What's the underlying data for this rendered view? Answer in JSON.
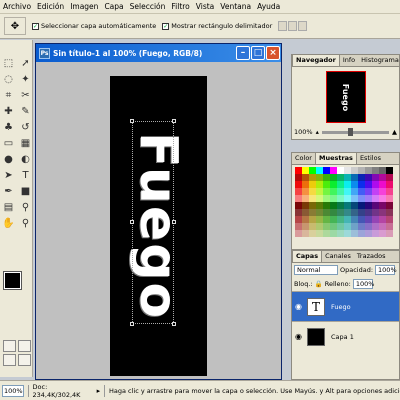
{
  "menu": [
    "Archivo",
    "Edición",
    "Imagen",
    "Capa",
    "Selección",
    "Filtro",
    "Vista",
    "Ventana",
    "Ayuda"
  ],
  "options": {
    "tool_icon": "move-tool-icon",
    "auto_select_label": "Seleccionar capa automáticamente",
    "auto_select_checked": true,
    "show_bounds_label": "Mostrar rectángulo delimitador",
    "show_bounds_checked": true
  },
  "document": {
    "title": "Sin título-1 al 100% (Fuego, RGB/8)",
    "canvas_text": "Fuego",
    "canvas_bg": "#000000"
  },
  "navigator": {
    "tabs": [
      "Navegador",
      "Info",
      "Histograma"
    ],
    "zoom": "100%",
    "preview_text": "Fuego"
  },
  "color_panel": {
    "tabs": [
      "Color",
      "Muestras",
      "Estilos"
    ]
  },
  "layers_panel": {
    "tabs": [
      "Capas",
      "Canales",
      "Trazados"
    ],
    "blend_mode": "Normal",
    "opacity_label": "Opacidad:",
    "opacity": "100%",
    "lock_label": "Bloq.:",
    "fill_label": "Relleno:",
    "fill": "100%",
    "layers": [
      {
        "name": "Fuego",
        "type": "text",
        "selected": true
      },
      {
        "name": "Capa 1",
        "type": "raster",
        "selected": false
      }
    ]
  },
  "status": {
    "zoom": "100%",
    "doc_info": "Doc: 234,4K/302,4K",
    "hint": "Haga clic y arrastre para mover la capa o selección. Use Mayús. y Alt para opciones adicionales."
  },
  "colors": {
    "accent": "#316ac5",
    "titlebar": "#0a5ccf",
    "foreground": "#000000",
    "background": "#000000"
  }
}
